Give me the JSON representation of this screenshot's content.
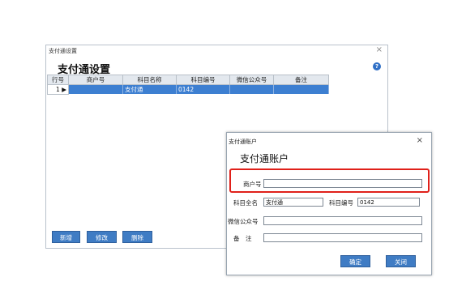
{
  "main_window": {
    "title": "支付通设置",
    "close_symbol": "×",
    "heading": "支付通设置",
    "help_symbol": "?",
    "table": {
      "columns": [
        "行号",
        "商户号",
        "科目名称",
        "科目编号",
        "微信公众号",
        "备注"
      ],
      "rows": [
        {
          "row_no": "1",
          "merchant_no": "",
          "account_name": "支付通",
          "account_code": "0142",
          "wechat": "",
          "remark": ""
        }
      ]
    },
    "buttons": {
      "add": "新增",
      "edit": "修改",
      "delete": "删除"
    }
  },
  "dialog": {
    "title": "支付通账户",
    "close_symbol": "×",
    "heading": "支付通账户",
    "fields": {
      "merchant_label": "商户号",
      "merchant_value": "",
      "account_fullname_label": "科目全名",
      "account_fullname_value": "支付通",
      "account_code_label": "科目编号",
      "account_code_value": "0142",
      "wechat_label": "微信公众号",
      "wechat_value": "",
      "remark_label": "备　注",
      "remark_value": ""
    },
    "buttons": {
      "ok": "确定",
      "close": "关闭"
    }
  },
  "colors": {
    "accent": "#3f7cc4",
    "selected_row": "#3d7fd1",
    "highlight": "#e0201a"
  }
}
